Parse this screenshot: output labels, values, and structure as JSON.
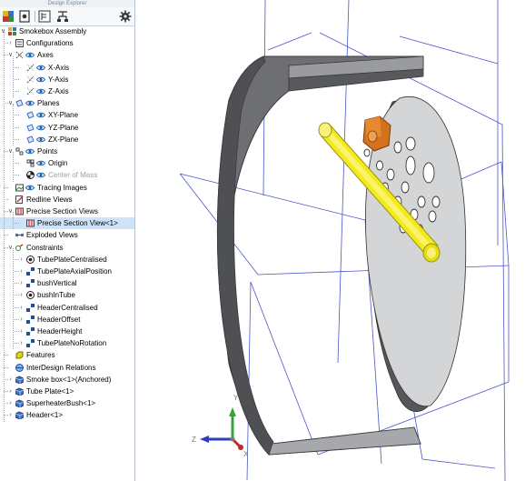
{
  "panel": {
    "title": "Design Explorer",
    "toolbar": [
      "assembly-icon",
      "settings-icon",
      "tree-view-icon",
      "hierarchy-icon",
      "gear-icon"
    ]
  },
  "tree": [
    {
      "label": "Smokebox Assembly",
      "level": 0,
      "expander": "-",
      "icon": "assembly-icon",
      "eye": false,
      "selected": false,
      "grey": false
    },
    {
      "label": "Configurations",
      "level": 1,
      "expander": "+",
      "icon": "configurations-icon",
      "eye": false,
      "selected": false,
      "grey": false
    },
    {
      "label": "Axes",
      "level": 1,
      "expander": "-",
      "icon": "axes-icon",
      "eye": true,
      "selected": false,
      "grey": false
    },
    {
      "label": "X-Axis",
      "level": 2,
      "expander": "",
      "icon": "axis-icon",
      "eye": true,
      "selected": false,
      "grey": false
    },
    {
      "label": "Y-Axis",
      "level": 2,
      "expander": "",
      "icon": "axis-icon",
      "eye": true,
      "selected": false,
      "grey": false
    },
    {
      "label": "Z-Axis",
      "level": 2,
      "expander": "",
      "icon": "axis-icon",
      "eye": true,
      "selected": false,
      "grey": false
    },
    {
      "label": "Planes",
      "level": 1,
      "expander": "-",
      "icon": "planes-icon",
      "eye": true,
      "selected": false,
      "grey": false
    },
    {
      "label": "XY-Plane",
      "level": 2,
      "expander": "",
      "icon": "plane-icon",
      "eye": true,
      "selected": false,
      "grey": false
    },
    {
      "label": "YZ-Plane",
      "level": 2,
      "expander": "",
      "icon": "plane-icon",
      "eye": true,
      "selected": false,
      "grey": false
    },
    {
      "label": "ZX-Plane",
      "level": 2,
      "expander": "",
      "icon": "plane-icon",
      "eye": true,
      "selected": false,
      "grey": false
    },
    {
      "label": "Points",
      "level": 1,
      "expander": "-",
      "icon": "points-icon",
      "eye": true,
      "selected": false,
      "grey": false
    },
    {
      "label": "Origin",
      "level": 2,
      "expander": "",
      "icon": "point-icon",
      "eye": true,
      "selected": false,
      "grey": false
    },
    {
      "label": "Center of Mass",
      "level": 2,
      "expander": "",
      "icon": "center-of-mass-icon",
      "eye": true,
      "selected": false,
      "grey": true
    },
    {
      "label": "Tracing Images",
      "level": 1,
      "expander": "",
      "icon": "image-icon",
      "eye": true,
      "selected": false,
      "grey": false
    },
    {
      "label": "Redline Views",
      "level": 1,
      "expander": "",
      "icon": "redline-icon",
      "eye": false,
      "selected": false,
      "grey": false
    },
    {
      "label": "Precise Section Views",
      "level": 1,
      "expander": "-",
      "icon": "section-views-icon",
      "eye": false,
      "selected": false,
      "grey": false
    },
    {
      "label": "Precise Section View<1>",
      "level": 2,
      "expander": "",
      "icon": "section-view-icon",
      "eye": false,
      "selected": true,
      "grey": false
    },
    {
      "label": "Exploded Views",
      "level": 1,
      "expander": "",
      "icon": "exploded-icon",
      "eye": false,
      "selected": false,
      "grey": false
    },
    {
      "label": "Constraints",
      "level": 1,
      "expander": "-",
      "icon": "constraints-icon",
      "eye": false,
      "selected": false,
      "grey": false
    },
    {
      "label": "TubePlateCentralised",
      "level": 2,
      "expander": "+",
      "icon": "concentric-icon",
      "eye": false,
      "selected": false,
      "grey": false
    },
    {
      "label": "TubePlateAxialPosition",
      "level": 2,
      "expander": "+",
      "icon": "distance-icon",
      "eye": false,
      "selected": false,
      "grey": false
    },
    {
      "label": "bushVertical",
      "level": 2,
      "expander": "+",
      "icon": "distance-icon",
      "eye": false,
      "selected": false,
      "grey": false
    },
    {
      "label": "bushInTube",
      "level": 2,
      "expander": "+",
      "icon": "concentric-icon",
      "eye": false,
      "selected": false,
      "grey": false
    },
    {
      "label": "HeaderCentralised",
      "level": 2,
      "expander": "+",
      "icon": "distance-icon",
      "eye": false,
      "selected": false,
      "grey": false
    },
    {
      "label": "HeaderOffset",
      "level": 2,
      "expander": "+",
      "icon": "distance-icon",
      "eye": false,
      "selected": false,
      "grey": false
    },
    {
      "label": "HeaderHeight",
      "level": 2,
      "expander": "+",
      "icon": "distance-icon",
      "eye": false,
      "selected": false,
      "grey": false
    },
    {
      "label": "TubePlateNoRotation",
      "level": 2,
      "expander": "+",
      "icon": "distance-icon",
      "eye": false,
      "selected": false,
      "grey": false
    },
    {
      "label": "Features",
      "level": 1,
      "expander": "",
      "icon": "features-icon",
      "eye": false,
      "selected": false,
      "grey": false
    },
    {
      "label": "InterDesign Relations",
      "level": 1,
      "expander": "",
      "icon": "relations-icon",
      "eye": false,
      "selected": false,
      "grey": false
    },
    {
      "label": "Smoke box<1>(Anchored)",
      "level": 1,
      "expander": "+",
      "icon": "part-icon",
      "eye": false,
      "selected": false,
      "grey": false
    },
    {
      "label": "Tube Plate<1>",
      "level": 1,
      "expander": "+",
      "icon": "part-icon",
      "eye": false,
      "selected": false,
      "grey": false
    },
    {
      "label": "SuperheaterBush<1>",
      "level": 1,
      "expander": "+",
      "icon": "part-icon",
      "eye": false,
      "selected": false,
      "grey": false
    },
    {
      "label": "Header<1>",
      "level": 1,
      "expander": "+",
      "icon": "part-icon",
      "eye": false,
      "selected": false,
      "grey": false
    }
  ],
  "viewport": {
    "triad": {
      "x_label": "X",
      "y_label": "Y",
      "z_label": "Z"
    },
    "colors": {
      "shell": "#6e6f72",
      "plate": "#d4d5d7",
      "tube": "#f2ea1f",
      "bush": "#d2721c",
      "plane_lines": "#4a55c8",
      "selection": "#cfe3f8"
    }
  }
}
